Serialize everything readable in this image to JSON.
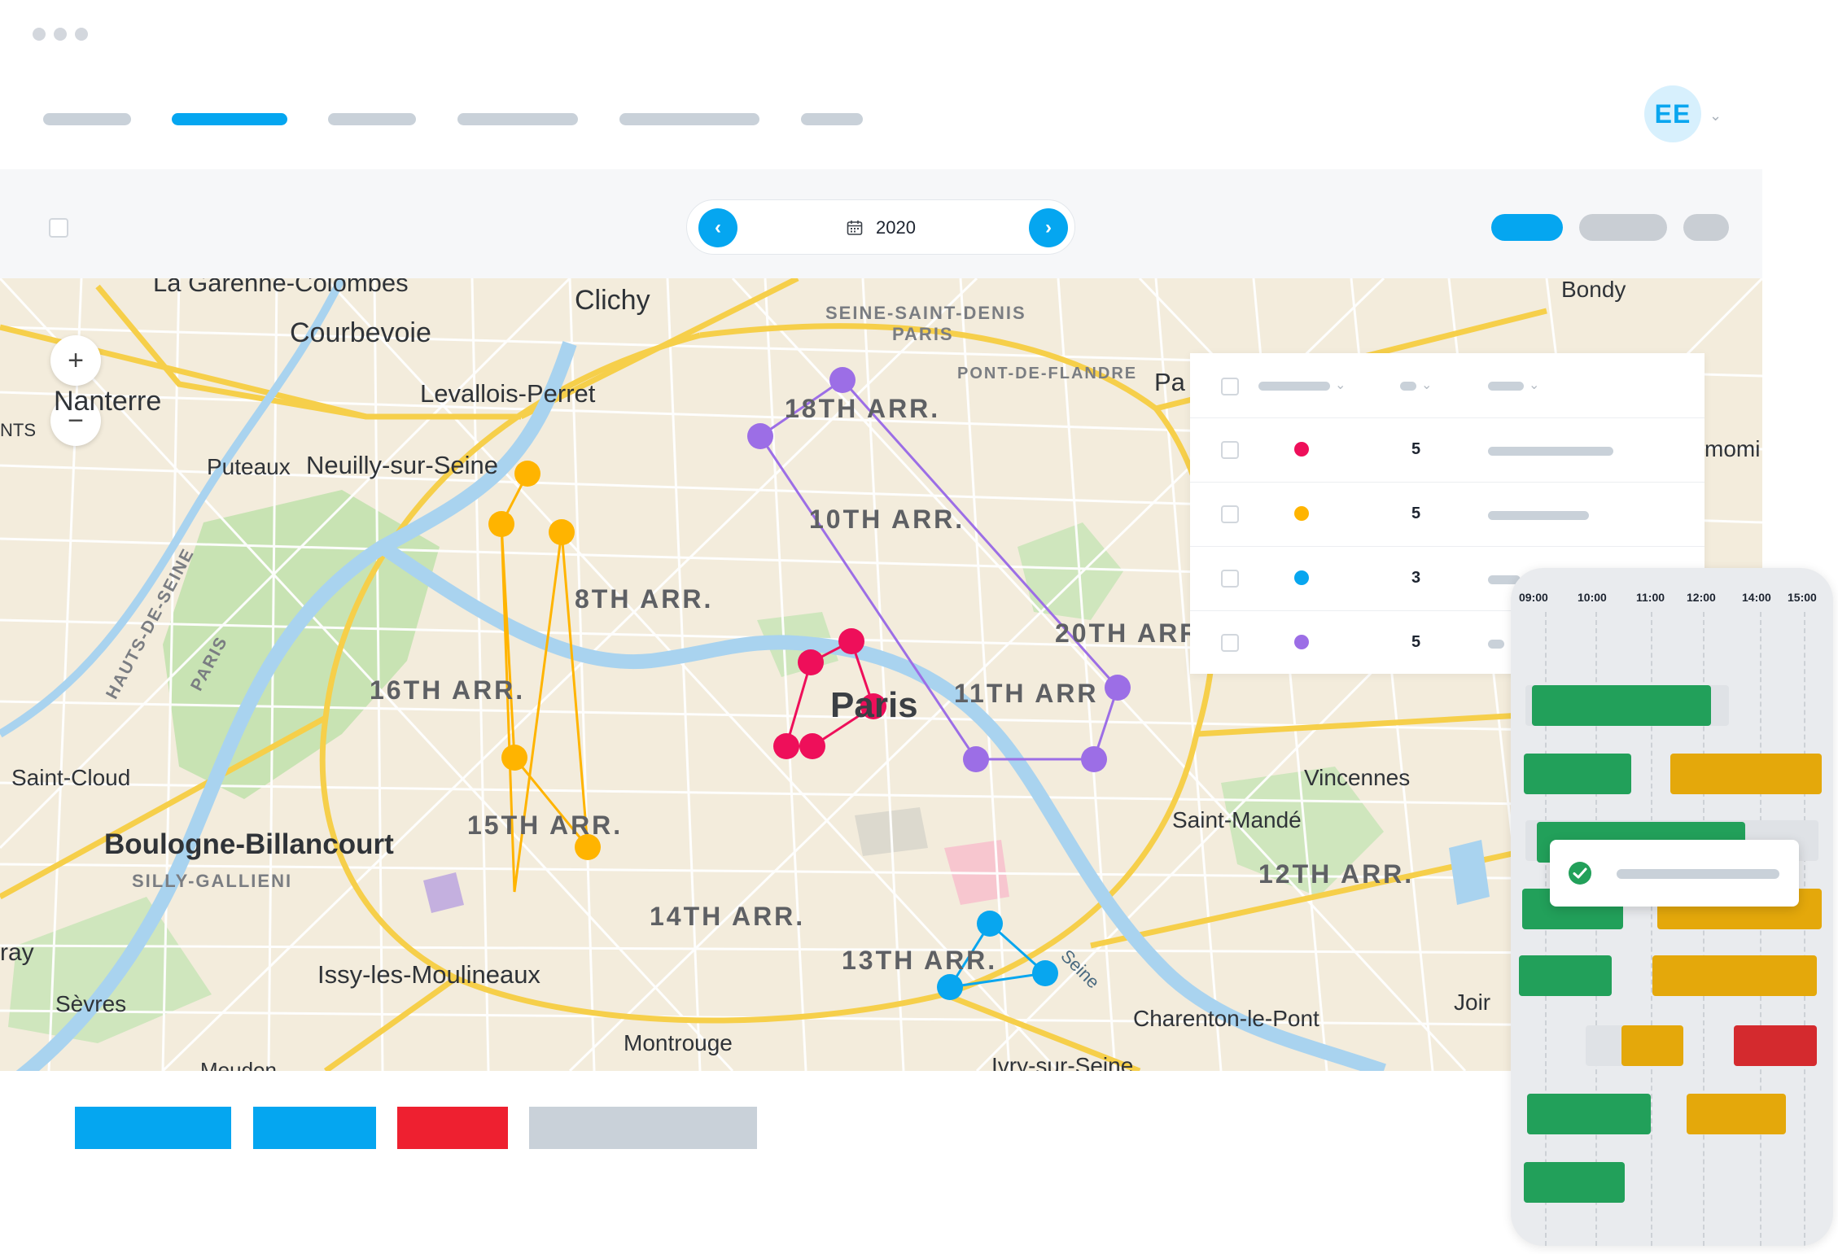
{
  "window": {
    "controls": [
      "dot",
      "dot",
      "dot"
    ]
  },
  "nav": {
    "items": [
      {
        "label": "",
        "active": false
      },
      {
        "label": "",
        "active": true
      },
      {
        "label": "",
        "active": false
      },
      {
        "label": "",
        "active": false
      },
      {
        "label": "",
        "active": false
      },
      {
        "label": "",
        "active": false
      }
    ]
  },
  "user": {
    "initials": "EE",
    "caret_icon": "chevron-down-icon"
  },
  "toolbar": {
    "date": {
      "value": "2020",
      "icon": "calendar-icon",
      "prev_icon": "chevron-left-icon",
      "next_icon": "chevron-right-icon"
    }
  },
  "map": {
    "zoom_in": "+",
    "zoom_out": "−",
    "places": {
      "la_garenne": "La Garenne-Colombes",
      "clichy": "Clichy",
      "courbevoie": "Courbevoie",
      "nanterre": "Nanterre",
      "levallois": "Levallois-Perret",
      "puteaux": "Puteaux",
      "neuilly": "Neuilly-sur-Seine",
      "seine_saint_denis": "SEINE-SAINT-DENIS",
      "paris_dept": "PARIS",
      "pont_de_flandre": "PONT-DE-FLANDRE",
      "pa": "Pa",
      "bondy": "Bondy",
      "saint_cloud": "Saint-Cloud",
      "boulogne": "Boulogne-Billancourt",
      "silly_gallieni": "SILLY-GALLIENI",
      "issy": "Issy-les-Moulineaux",
      "sevres": "Sèvres",
      "montrouge": "Montrouge",
      "meudon": "Meudon",
      "ivry": "Ivry-sur-Seine",
      "vincennes": "Vincennes",
      "saint_mande": "Saint-Mandé",
      "charenton": "Charenton-le-Pont",
      "joinville": "Joir",
      "paris": "Paris",
      "hauts_de_seine": "HAUTS-DE-SEINE",
      "paris_vertical": "PARIS",
      "seine": "Seine",
      "edge_nts": "NTS",
      "edge_ray": "ray",
      "edge_romi": "momi"
    },
    "arrondissements": {
      "a18": "18TH ARR.",
      "a10": "10TH ARR.",
      "a8": "8TH ARR.",
      "a16": "16TH ARR.",
      "a20": "20TH ARR",
      "a11": "11TH ARR",
      "a15": "15TH ARR.",
      "a14": "14TH ARR.",
      "a13": "13TH ARR.",
      "a12": "12TH ARR."
    },
    "route_colors": {
      "yellow": "#ffb400",
      "purple": "#9c6ee6",
      "pink": "#ee0f5a",
      "blue": "#08a6ef"
    }
  },
  "routes_table": {
    "rows": [
      {
        "color": "#ee0f5a",
        "count": "5"
      },
      {
        "color": "#ffb400",
        "count": "5"
      },
      {
        "color": "#08a6ef",
        "count": "3"
      },
      {
        "color": "#9c6ee6",
        "count": "5"
      }
    ]
  },
  "actions": {
    "buttons": [
      {
        "color": "#05a6f0"
      },
      {
        "color": "#05a6f0"
      },
      {
        "color": "#ee2030"
      },
      {
        "color": "#c9d1d9"
      }
    ]
  },
  "schedule": {
    "times": [
      "09:00",
      "10:00",
      "11:00",
      "12:00",
      "14:00",
      "15:00"
    ],
    "toast_icon": "check-circle-icon"
  }
}
